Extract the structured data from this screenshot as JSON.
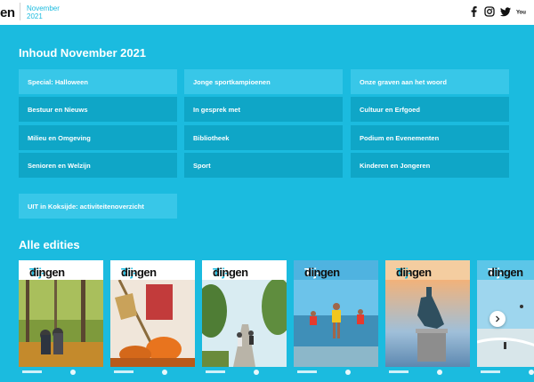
{
  "header": {
    "logo_fragment": "en",
    "edition_month": "November",
    "edition_year": "2021",
    "social_icons": [
      "facebook-icon",
      "instagram-icon",
      "twitter-icon",
      "youtube-icon"
    ]
  },
  "contents": {
    "title": "Inhoud November 2021",
    "tiles": [
      {
        "label": "Special: Halloween",
        "style": "light"
      },
      {
        "label": "Jonge sportkampioenen",
        "style": "light"
      },
      {
        "label": "Onze graven aan het woord",
        "style": "light"
      },
      {
        "label": "Bestuur en Nieuws",
        "style": "dark"
      },
      {
        "label": "In gesprek met",
        "style": "dark"
      },
      {
        "label": "Cultuur en Erfgoed",
        "style": "dark"
      },
      {
        "label": "Milieu en Omgeving",
        "style": "dark"
      },
      {
        "label": "Bibliotheek",
        "style": "dark"
      },
      {
        "label": "Podium en Evenementen",
        "style": "dark"
      },
      {
        "label": "Senioren en Welzijn",
        "style": "dark"
      },
      {
        "label": "Sport",
        "style": "dark"
      },
      {
        "label": "Kinderen en Jongeren",
        "style": "dark"
      },
      {
        "label": "UIT in Koksijde: activiteitenoverzicht",
        "style": "light"
      }
    ]
  },
  "editions": {
    "title": "Alle edities",
    "masthead_prefix": "Tij-",
    "masthead_word": "dingen",
    "covers": [
      {
        "theme": "autumn-forest"
      },
      {
        "theme": "halloween"
      },
      {
        "theme": "cyclists"
      },
      {
        "theme": "beach-runners"
      },
      {
        "theme": "statue-sunset"
      },
      {
        "theme": "kitesurf"
      }
    ]
  },
  "colors": {
    "accent": "#1bbbdf",
    "tile_dark": "#0fa6c7",
    "tile_light": "#38c7e8"
  }
}
